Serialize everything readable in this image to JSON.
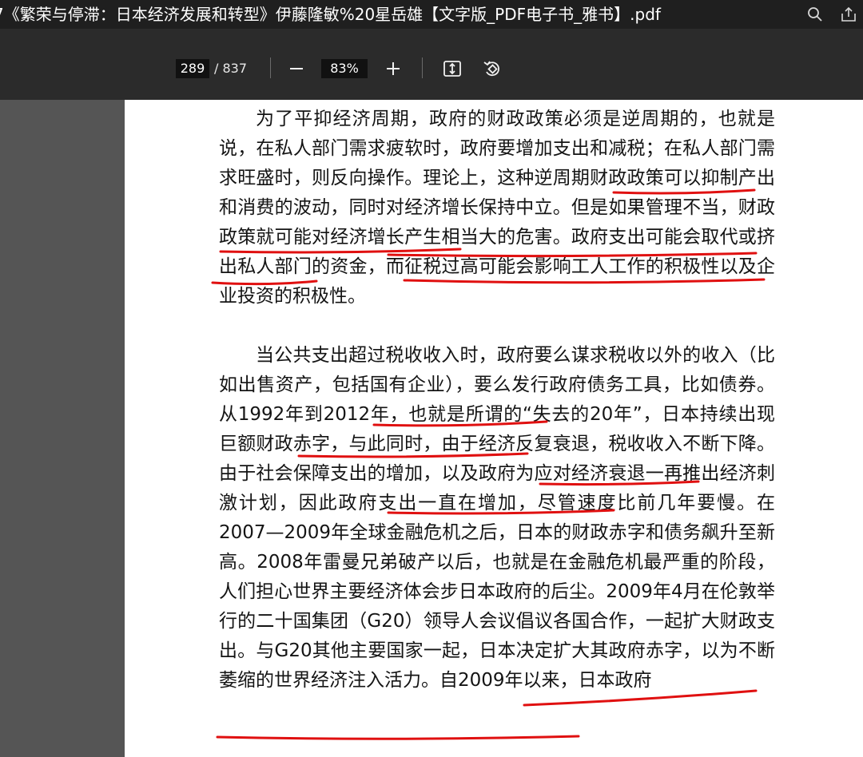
{
  "window": {
    "title": "7《繁荣与停滞：日本经济发展和转型》伊藤隆敏%20星岳雄【文字版_PDF电子书_雅书】.pdf",
    "icons": [
      "search-icon",
      "share-icon"
    ]
  },
  "toolbar": {
    "current_page": "289",
    "total_pages": "/ 837",
    "zoom": "83%",
    "icons": [
      "zoom-out-icon",
      "zoom-in-icon",
      "fit-page-icon",
      "rotate-icon"
    ]
  },
  "document": {
    "paragraph_1": "为了平抑经济周期，政府的财政政策必须是逆周期的，也就是说，在私人部门需求疲软时，政府要增加支出和减税；在私人部门需求旺盛时，则反向操作。理论上，这种逆周期财政政策可以抑制产出和消费的波动，同时对经济增长保持中立。但是如果管理不当，财政政策就可能对经济增长产生相当大的危害。政府支出可能会取代或挤出私人部门的资金，而征税过高可能会影响工人工作的积极性以及企业投资的积极性。",
    "paragraph_2": "当公共支出超过税收收入时，政府要么谋求税收以外的收入（比如出售资产，包括国有企业），要么发行政府债务工具，比如债券。从1992年到2012年，也就是所谓的“失去的20年”，日本持续出现巨额财政赤字，与此同时，由于经济反复衰退，税收收入不断下降。由于社会保障支出的增加，以及政府为应对经济衰退一再推出经济刺激计划，因此政府支出一直在增加，尽管速度比前几年要慢。在2007—2009年全球金融危机之后，日本的财政赤字和债务飙升至新高。2008年雷曼兄弟破产以后，也就是在金融危机最严重的阶段，人们担心世界主要经济体会步日本政府的后尘。2009年4月在伦敦举行的二十国集团（G20）领导人会议倡议各国合作，一起扩大财政支出。与G20其他主要国家一起，日本决定扩大其政府赤字，以为不断萎缩的世界经济注入活力。自2009年以来，日本政府"
  },
  "colors": {
    "titlebar": "#1f1f1f",
    "toolbar": "#2b2b2b",
    "sidebar": "#555555",
    "page": "#ffffff",
    "underline": "#e01010"
  }
}
